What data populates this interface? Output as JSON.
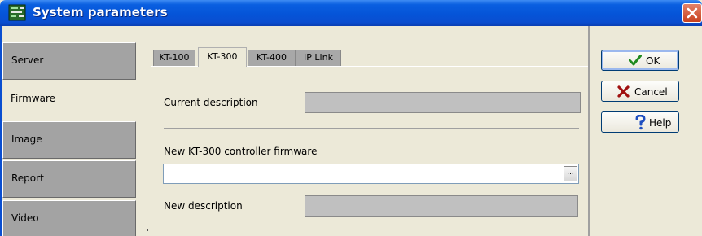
{
  "window": {
    "title": "System parameters"
  },
  "nav": {
    "items": [
      {
        "label": "Server"
      },
      {
        "label": "Firmware",
        "active": true
      },
      {
        "label": "Image"
      },
      {
        "label": "Report"
      },
      {
        "label": "Video"
      }
    ]
  },
  "tabs": [
    {
      "label": "KT-100"
    },
    {
      "label": "KT-300",
      "active": true
    },
    {
      "label": "KT-400"
    },
    {
      "label": "IP Link"
    }
  ],
  "form": {
    "current_description_label": "Current description",
    "current_description_value": "",
    "new_firmware_label": "New KT-300 controller firmware",
    "new_firmware_value": "",
    "browse_label": "...",
    "new_description_label": "New description",
    "new_description_value": ""
  },
  "buttons": {
    "ok": "OK",
    "cancel": "Cancel",
    "help": "Help"
  },
  "icons": {
    "app": "system-parameters-icon",
    "close": "close-icon",
    "ok": "checkmark-icon",
    "cancel": "x-cross-icon",
    "help": "question-mark-icon"
  },
  "colors": {
    "titlebar": "#0554d8",
    "close_button": "#c8401e",
    "ok_check": "#1f8a1f",
    "cancel_x": "#a01010",
    "help_q": "#1f4fc0"
  }
}
